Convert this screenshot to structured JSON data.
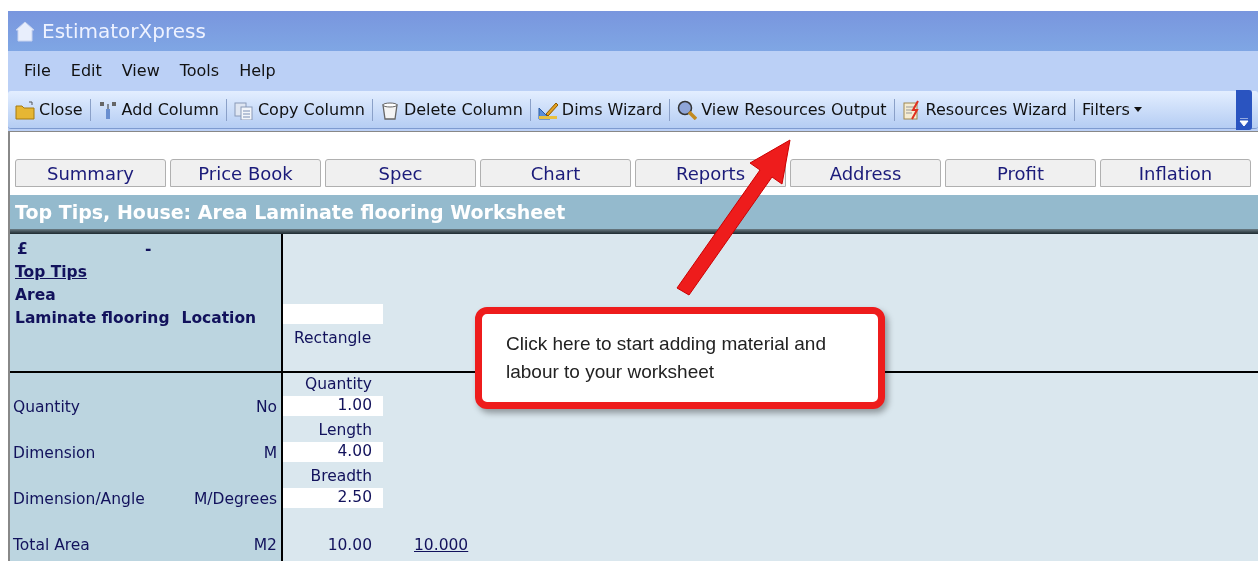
{
  "window": {
    "title": "EstimatorXpress"
  },
  "menu": [
    "File",
    "Edit",
    "View",
    "Tools",
    "Help"
  ],
  "toolbar": [
    {
      "label": "Close",
      "kind": "folder"
    },
    {
      "label": "Add Column",
      "kind": "add"
    },
    {
      "label": "Copy Column",
      "kind": "copy"
    },
    {
      "label": "Delete Column",
      "kind": "bucket"
    },
    {
      "label": "Dims Wizard",
      "kind": "ruler"
    },
    {
      "label": "View Resources Output",
      "kind": "magnifier"
    },
    {
      "label": "Resources Wizard",
      "kind": "wizard"
    },
    {
      "label": "Filters",
      "kind": "dropdown"
    }
  ],
  "tabs": [
    "Summary",
    "Price Book",
    "Spec",
    "Chart",
    "Reports",
    "Address",
    "Profit",
    "Inflation"
  ],
  "sheet": {
    "title": "Top Tips, House: Area Laminate flooring Worksheet",
    "header": {
      "currency": "£",
      "dash": "-",
      "project": "Top Tips",
      "category": "Area",
      "item": "Laminate flooring",
      "location_label": "Location",
      "shape": "Rectangle"
    },
    "rows": [
      {
        "label": "Quantity",
        "unit": "No",
        "field_label": "Quantity",
        "value": "1.00"
      },
      {
        "label": "Dimension",
        "unit": "M",
        "field_label": "Length",
        "value": "4.00"
      },
      {
        "label": "Dimension/Angle",
        "unit": "M/Degrees",
        "field_label": "Breadth",
        "value": "2.50"
      }
    ],
    "total": {
      "label": "Total Area",
      "unit": "M2",
      "value": "10.00",
      "link": "10.000"
    }
  },
  "callout": {
    "text": "Click here to start adding material and labour to your worksheet"
  }
}
